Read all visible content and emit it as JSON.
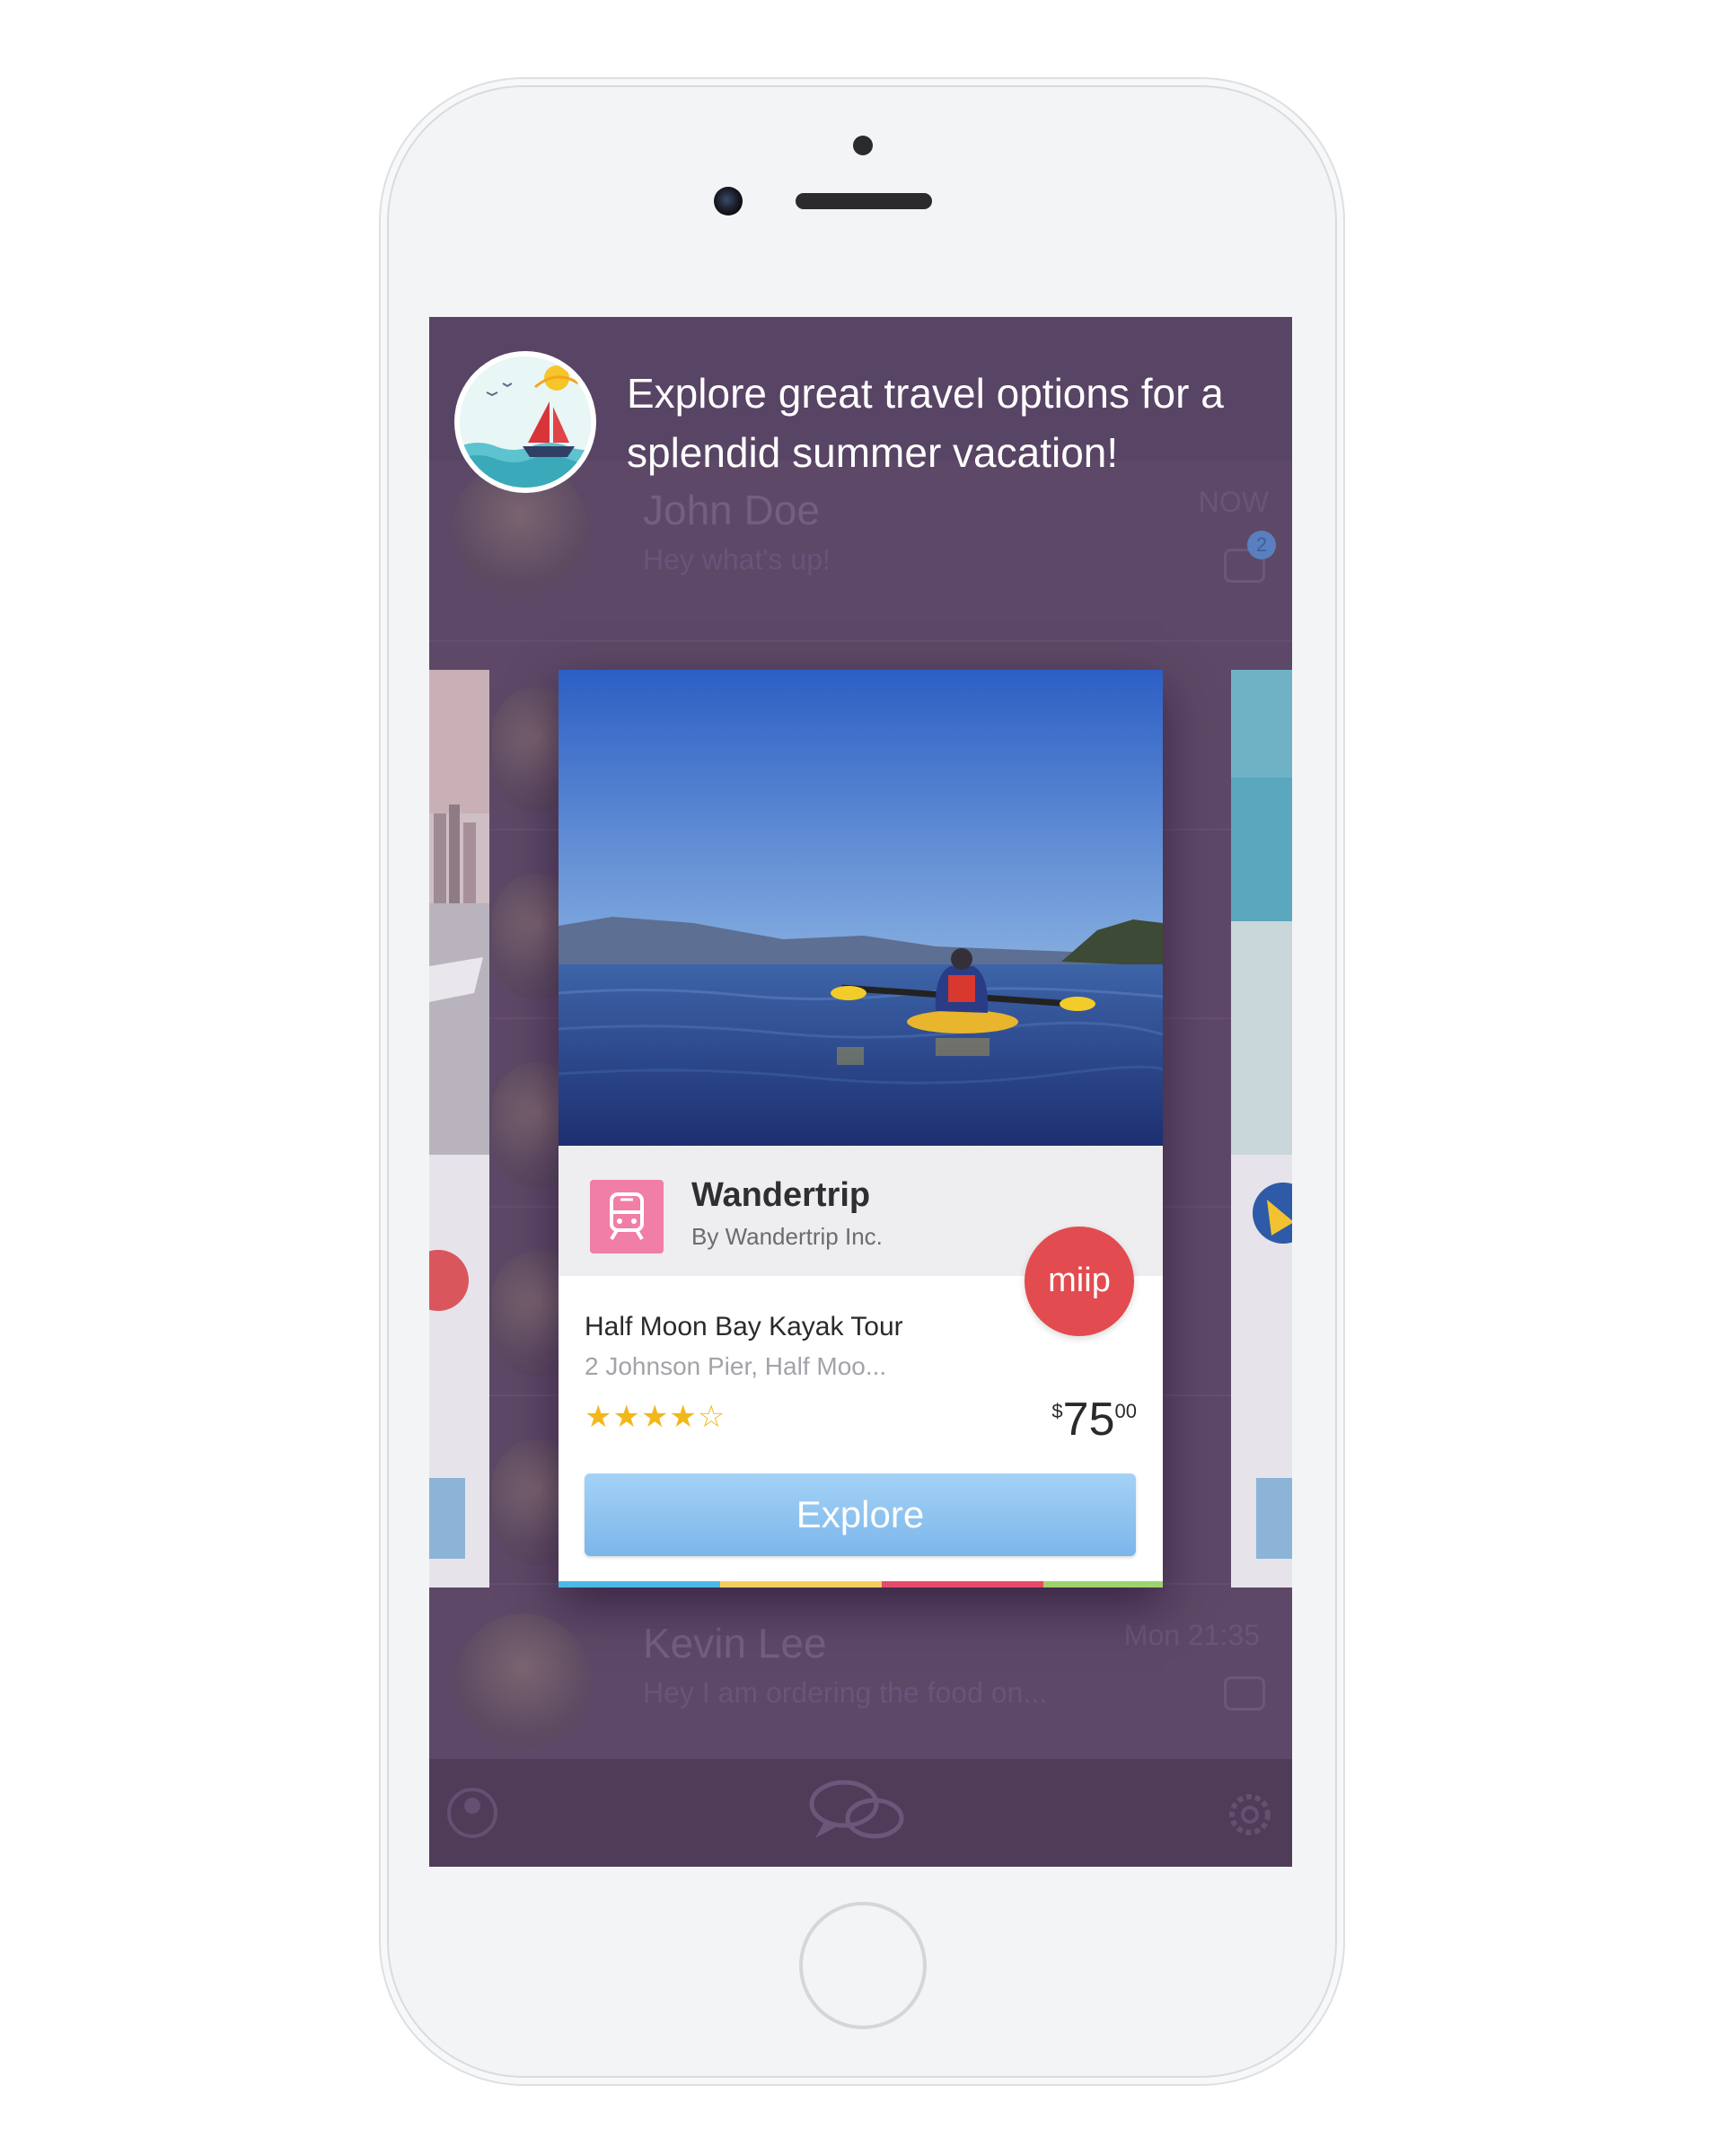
{
  "notification": {
    "text": "Explore great travel options for a splendid summer vacation!"
  },
  "conversations": [
    {
      "name": "John Doe",
      "message": "Hey what's up!",
      "time": "NOW",
      "unread": "2"
    },
    {
      "name": "Kevin Lee",
      "message": "Hey I am ordering the food on...",
      "time": "Mon 21:35"
    }
  ],
  "card": {
    "app_name": "Wandertrip",
    "publisher": "By Wandertrip Inc.",
    "badge": "miip",
    "title": "Half Moon Bay Kayak Tour",
    "address": "2 Johnson Pier, Half Moo...",
    "rating": "★★★★☆",
    "price_currency": "$",
    "price_whole": "75",
    "price_cents": "00",
    "cta": "Explore"
  },
  "colors": {
    "screen_bg": "#5d4867",
    "badge_red": "#e24b4f",
    "button_blue": "#7bb6ea",
    "star_gold": "#f2b81b",
    "app_icon_pink": "#f07ea6"
  },
  "icons": [
    "train-icon",
    "chat-icon",
    "profile-icon",
    "chat-bubbles-icon",
    "gear-icon",
    "sailboat-icon"
  ]
}
